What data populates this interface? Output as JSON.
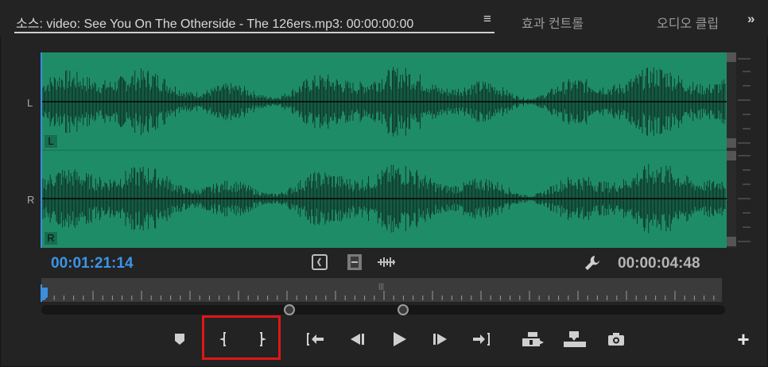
{
  "tabs": {
    "active": "소스: video: See You On The Otherside - The 126ers.mp3: 00:00:00:00",
    "menu_icon": "≡",
    "second": "효과 컨트롤",
    "third": "오디오 클립 믹서",
    "overflow_icon": "»"
  },
  "channels": {
    "left_label": "L",
    "left_tag": "L",
    "right_label": "R",
    "right_tag": "R"
  },
  "timecodes": {
    "current": "00:01:21:14",
    "duration": "00:00:04:48"
  },
  "colors": {
    "waveform_bg": "#1f8c68",
    "accent": "#3b95e6",
    "highlight": "#e01616"
  },
  "icons": {
    "drag_video": "drag-video-icon",
    "drag_video_only": "film-strip-icon",
    "drag_audio": "audio-waveform-icon",
    "settings": "wrench-icon",
    "add_marker": "marker-icon",
    "mark_in": "mark-in-icon",
    "mark_out": "mark-out-icon",
    "go_to_in": "go-to-in-icon",
    "step_back": "step-back-icon",
    "play": "play-icon",
    "step_forward": "step-forward-icon",
    "go_to_out": "go-to-out-icon",
    "insert": "insert-icon",
    "overwrite": "overwrite-icon",
    "export_frame": "camera-icon",
    "add_button": "plus-icon"
  },
  "add_button_glyph": "+"
}
